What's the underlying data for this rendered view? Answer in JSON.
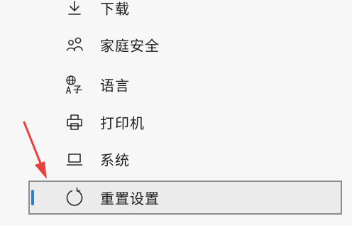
{
  "colors": {
    "background": "#f7f7f7",
    "accent": "#2e7fc8",
    "annotation_arrow": "#e8413c",
    "selected_border": "#8e8e8e"
  },
  "nav": {
    "items": [
      {
        "label": "下载",
        "icon": "download-icon"
      },
      {
        "label": "家庭安全",
        "icon": "family-safety-icon"
      },
      {
        "label": "语言",
        "icon": "language-icon"
      },
      {
        "label": "打印机",
        "icon": "printer-icon"
      },
      {
        "label": "系统",
        "icon": "system-icon"
      },
      {
        "label": "重置设置",
        "icon": "reset-icon",
        "selected": true
      }
    ]
  }
}
